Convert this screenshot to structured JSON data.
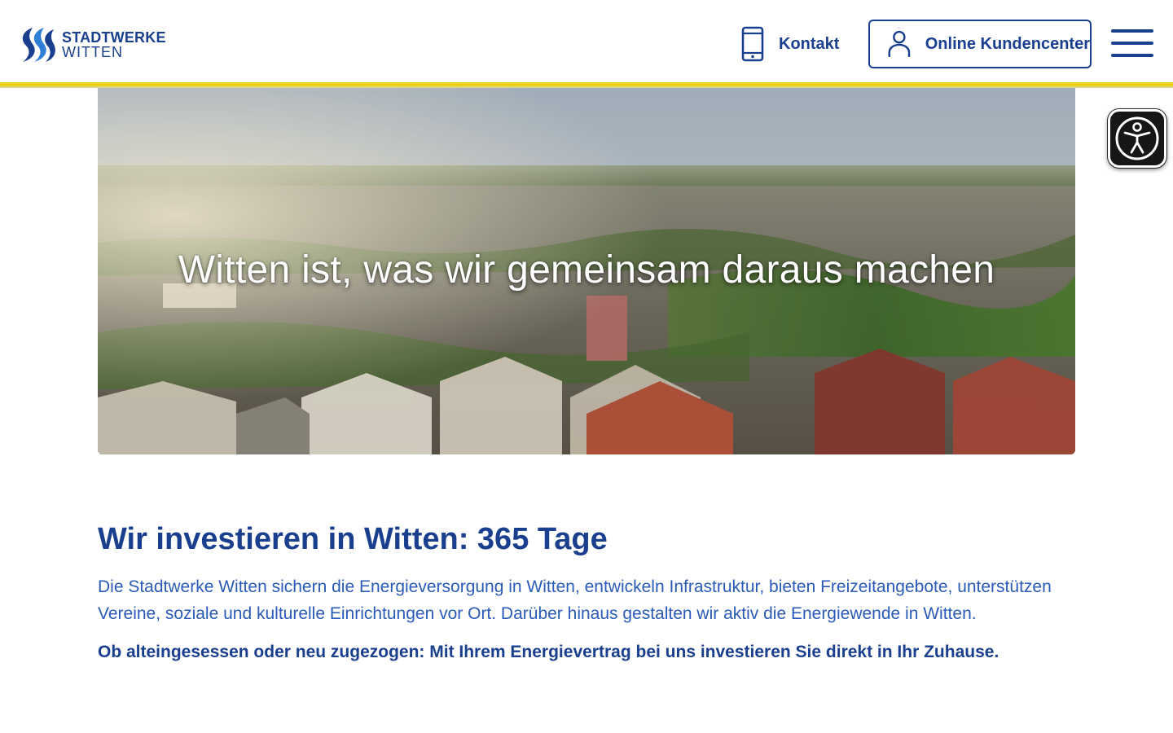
{
  "header": {
    "logo": {
      "line1": "STADTWERKE",
      "line2": "WITTEN"
    },
    "kontakt_label": "Kontakt",
    "kundencenter_label": "Online Kundencenter",
    "icons": {
      "kontakt": "smartphone-icon",
      "kundencenter": "user-icon",
      "menu": "hamburger-menu-icon"
    }
  },
  "accessibility": {
    "icon": "accessibility-person-icon"
  },
  "hero": {
    "title": "Witten ist, was wir gemeinsam daraus machen"
  },
  "intro": {
    "heading": "Wir investieren in Witten: 365 Tage",
    "paragraph": "Die Stadtwerke Witten sichern die Energieversorgung in Witten, entwickeln Infrastruktur, bieten Freizeitangebote, unterstützen Vereine, soziale und kulturelle Einrichtungen vor Ort. Darüber hinaus gestalten wir aktiv die Energiewende in Witten.",
    "emphasis": "Ob alteingesessen oder neu zugezogen: Mit Ihrem Energievertrag bei uns investieren Sie direkt in Ihr Zuhause."
  },
  "colors": {
    "brand_blue": "#1a3f8f",
    "text_blue": "#2a5bb8",
    "accent_yellow": "#f2d300"
  }
}
